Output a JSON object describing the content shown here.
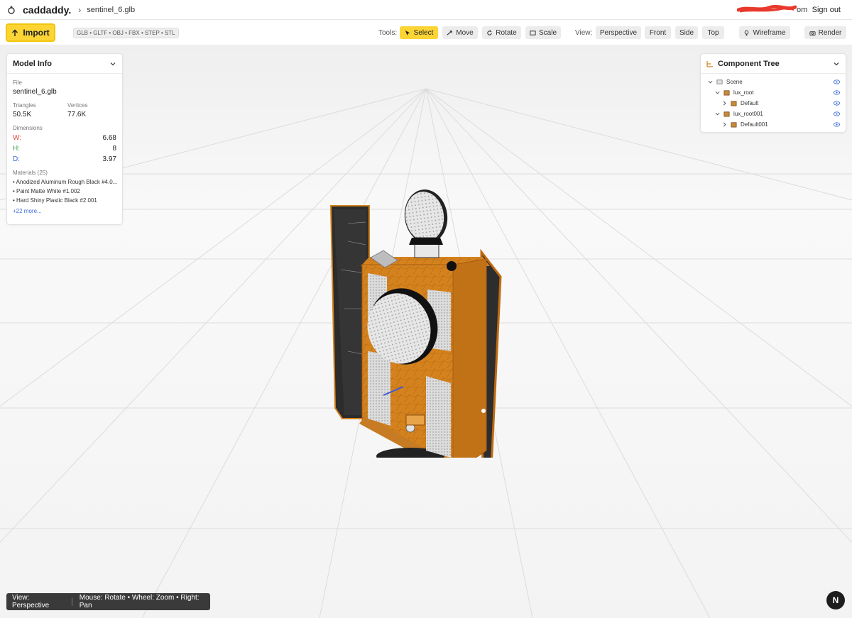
{
  "app": {
    "brand": "caddaddy.",
    "breadcrumb_file": "sentinel_6.glb"
  },
  "user": {
    "email_suffix": "om",
    "sign_out": "Sign out"
  },
  "toolbar": {
    "import_label": "Import",
    "formats": "GLB • GLTF • OBJ • FBX • STEP • STL",
    "tools_label": "Tools:",
    "tools": [
      {
        "label": "Select",
        "icon": "cursor-icon",
        "active": true
      },
      {
        "label": "Move",
        "icon": "move-icon",
        "active": false
      },
      {
        "label": "Rotate",
        "icon": "rotate-icon",
        "active": false
      },
      {
        "label": "Scale",
        "icon": "scale-icon",
        "active": false
      }
    ],
    "view_label": "View:",
    "views": [
      "Perspective",
      "Front",
      "Side",
      "Top"
    ],
    "wireframe_label": "Wireframe",
    "render_label": "Render"
  },
  "model_info": {
    "title": "Model Info",
    "file_label": "File",
    "file": "sentinel_6.glb",
    "triangles_label": "Triangles",
    "triangles": "50.5K",
    "vertices_label": "Vertices",
    "vertices": "77.6K",
    "dimensions_label": "Dimensions",
    "dims": [
      {
        "axis": "W:",
        "value": "6.68",
        "color": "#e0453a"
      },
      {
        "axis": "H:",
        "value": "8",
        "color": "#3aa04a"
      },
      {
        "axis": "D:",
        "value": "3.97",
        "color": "#3a6ad6"
      }
    ],
    "materials_label": "Materials (25)",
    "materials": [
      "• Anodized Aluminum Rough Black #4.0...",
      "• Paint Matte White #1.002",
      "• Hard Shiny Plastic Black #2.001"
    ],
    "more": "+22 more..."
  },
  "component_tree": {
    "title": "Component Tree",
    "nodes": [
      {
        "label": "Scene",
        "icon": "folder-icon"
      },
      {
        "label": "lux_root",
        "icon": "box-icon"
      },
      {
        "label": "Default",
        "icon": "box-icon"
      },
      {
        "label": "lux_root001",
        "icon": "box-icon"
      },
      {
        "label": "Default001",
        "icon": "box-icon"
      }
    ]
  },
  "status": {
    "view": "View: Perspective",
    "hint": "Mouse: Rotate • Wheel: Zoom • Right: Pan"
  },
  "badge": "N",
  "colors": {
    "accent": "#fcd535",
    "foil": "#d4821e",
    "panel": "#3a3a3a"
  }
}
